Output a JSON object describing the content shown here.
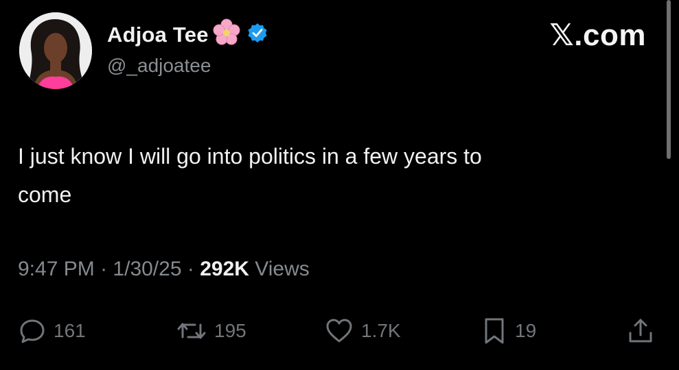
{
  "author": {
    "name": "Adjoa Tee",
    "handle": "@_adjoatee"
  },
  "brand": "𝕏.com",
  "tweet": {
    "text_line1": "I just know I will go into politics in a few years to",
    "text_line2": "come"
  },
  "meta": {
    "time": "9:47 PM",
    "sep1": "·",
    "date": "1/30/25",
    "sep2": "·",
    "views_count": "292K",
    "views_label": "Views"
  },
  "actions": {
    "replies": "161",
    "reposts": "195",
    "likes": "1.7K",
    "bookmarks": "19"
  },
  "colors": {
    "background": "#000000",
    "verified": "#1d9bf0",
    "muted": "#71767b",
    "flower": "#f7a8c8"
  },
  "icons": [
    "cherry-blossom-icon",
    "verified-badge-icon",
    "reply-icon",
    "repost-icon",
    "like-icon",
    "bookmark-icon",
    "share-icon"
  ]
}
